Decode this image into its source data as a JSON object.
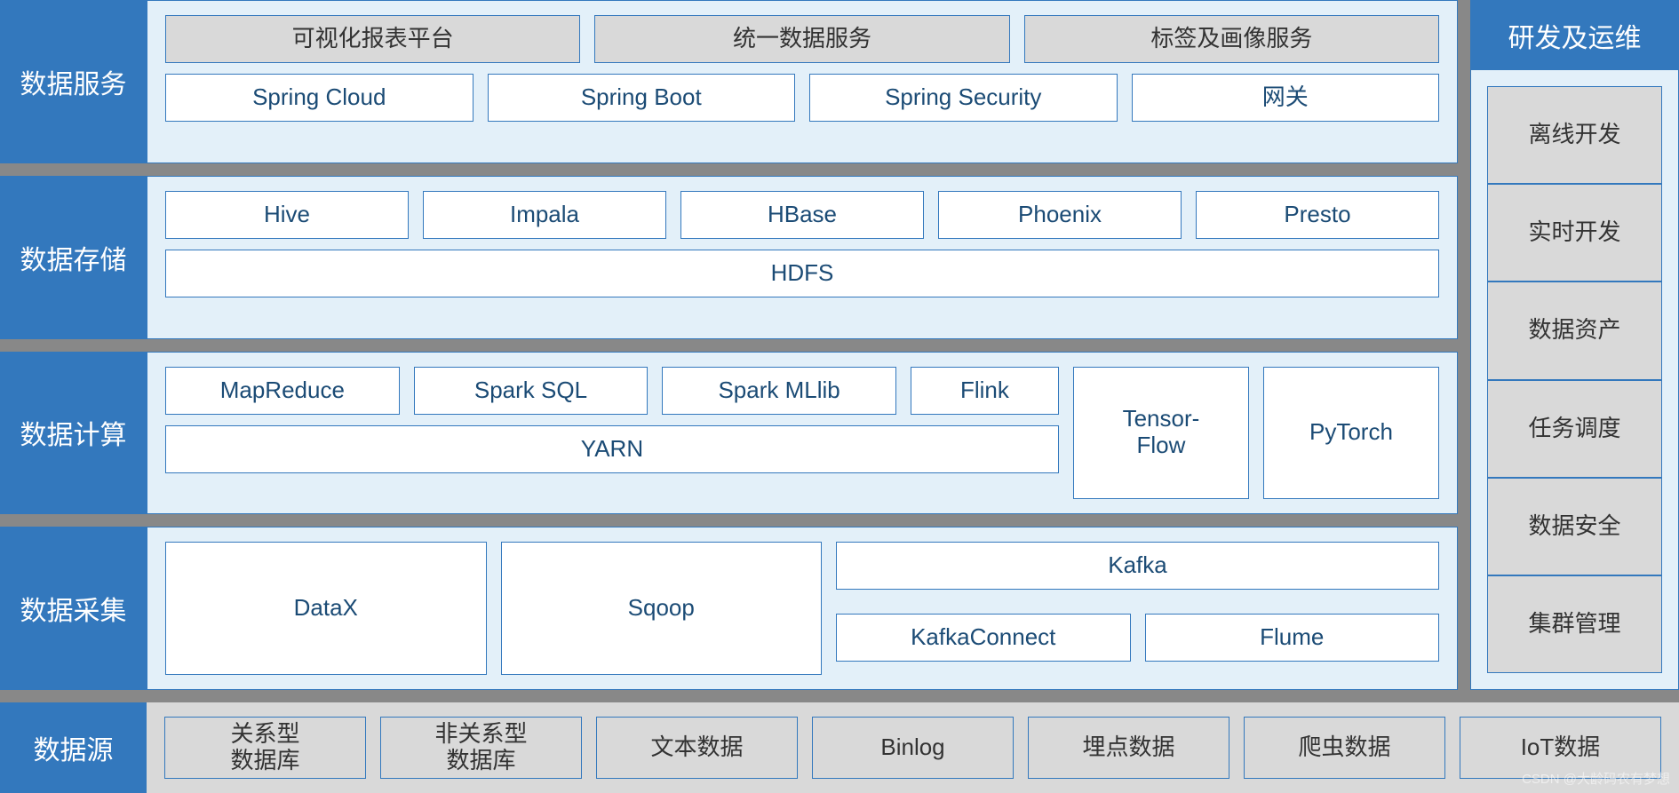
{
  "layers": {
    "service": {
      "label": "数据服务",
      "row1": [
        "可视化报表平台",
        "统一数据服务",
        "标签及画像服务"
      ],
      "row2": [
        "Spring Cloud",
        "Spring Boot",
        "Spring Security",
        "网关"
      ]
    },
    "storage": {
      "label": "数据存储",
      "row1": [
        "Hive",
        "Impala",
        "HBase",
        "Phoenix",
        "Presto"
      ],
      "row2": [
        "HDFS"
      ]
    },
    "compute": {
      "label": "数据计算",
      "left_row1": [
        "MapReduce",
        "Spark   SQL",
        "Spark   MLlib",
        "Flink"
      ],
      "left_row2": [
        "YARN"
      ],
      "right": [
        "Tensor-\nFlow",
        "PyTorch"
      ]
    },
    "ingest": {
      "label": "数据采集",
      "left": [
        "DataX",
        "Sqoop"
      ],
      "right_row1": [
        "Kafka"
      ],
      "right_row2": [
        "KafkaConnect",
        "Flume"
      ]
    },
    "source": {
      "label": "数据源",
      "items": [
        "关系型\n数据库",
        "非关系型\n数据库",
        "文本数据",
        "Binlog",
        "埋点数据",
        "爬虫数据",
        "IoT数据"
      ]
    }
  },
  "sidebar": {
    "title": "研发及运维",
    "items": [
      "离线开发",
      "实时开发",
      "数据资产",
      "任务调度",
      "数据安全",
      "集群管理"
    ]
  },
  "watermark": "CSDN @大龄码农有梦想"
}
